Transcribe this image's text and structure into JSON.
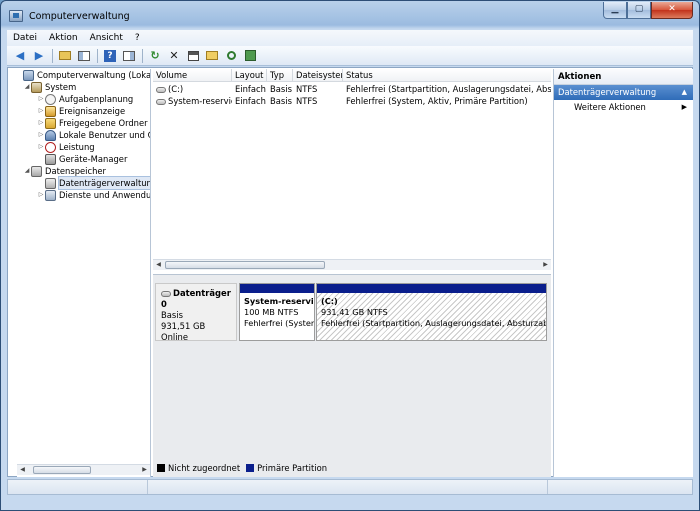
{
  "window": {
    "title": "Computerverwaltung"
  },
  "menu": [
    "Datei",
    "Aktion",
    "Ansicht",
    "?"
  ],
  "tree": {
    "root": "Computerverwaltung (Lokal)",
    "system": "System",
    "system_items": [
      "Aufgabenplanung",
      "Ereignisanzeige",
      "Freigegebene Ordner",
      "Lokale Benutzer und Gru",
      "Leistung",
      "Geräte-Manager"
    ],
    "storage": "Datenspeicher",
    "storage_items": [
      "Datenträgerverwaltung"
    ],
    "services": "Dienste und Anwendungen"
  },
  "volumes": {
    "columns": [
      "Volume",
      "Layout",
      "Typ",
      "Dateisystem",
      "Status"
    ],
    "rows": [
      {
        "volume": "(C:)",
        "layout": "Einfach",
        "typ": "Basis",
        "fs": "NTFS",
        "status": "Fehlerfrei (Startpartition, Auslagerungsdatei, Absturzabbil"
      },
      {
        "volume": "System-reserviert",
        "layout": "Einfach",
        "typ": "Basis",
        "fs": "NTFS",
        "status": "Fehlerfrei (System, Aktiv, Primäre Partition)"
      }
    ]
  },
  "disk": {
    "name": "Datenträger 0",
    "type": "Basis",
    "size": "931,51 GB",
    "state": "Online",
    "partitions": [
      {
        "name": "System-reserviert",
        "size": "100 MB NTFS",
        "status": "Fehlerfrei (System,"
      },
      {
        "name": "(C:)",
        "size": "931,41 GB NTFS",
        "status": "Fehlerfrei (Startpartition, Auslagerungsdatei, Absturzabbild, Pri"
      }
    ]
  },
  "legend": [
    {
      "label": "Nicht zugeordnet",
      "color": "#000000"
    },
    {
      "label": "Primäre Partition",
      "color": "#0a1e8c"
    }
  ],
  "actions": {
    "header": "Aktionen",
    "section": "Datenträgerverwaltung",
    "items": [
      "Weitere Aktionen"
    ]
  }
}
